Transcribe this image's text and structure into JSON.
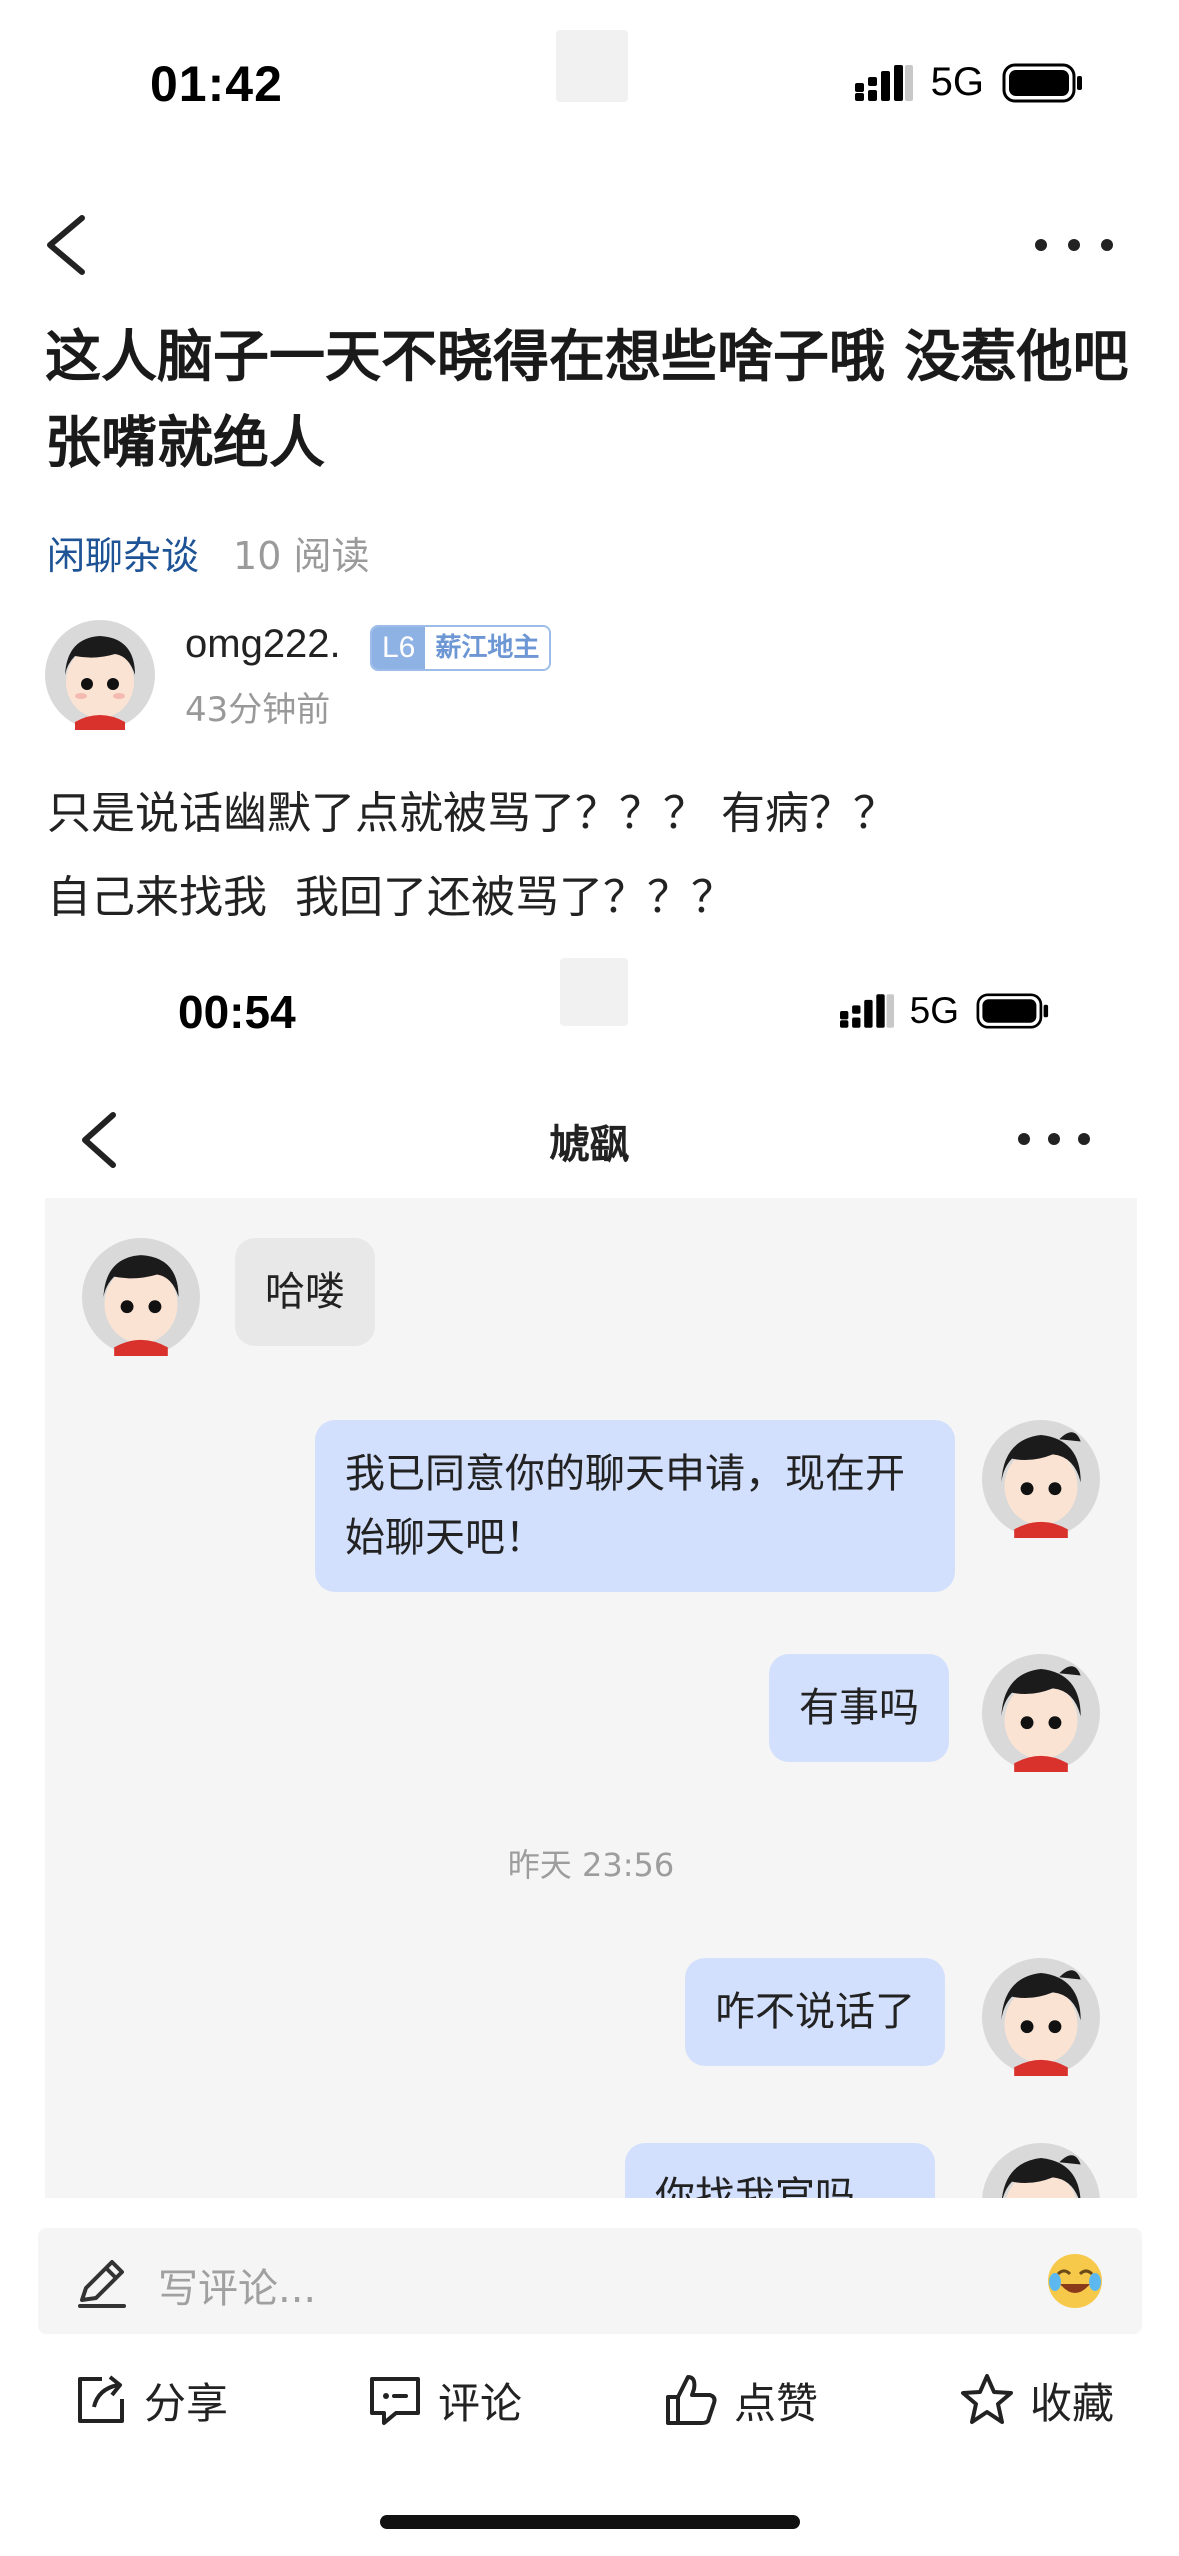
{
  "status_bar": {
    "time": "01:42",
    "network": "5G"
  },
  "post": {
    "title": " 这人脑子一天不晓得在想些啥子哦 没惹他吧 张嘴就绝人",
    "category": "闲聊杂谈",
    "reads": "10 阅读",
    "author": {
      "name": "omg222.",
      "level": "L6",
      "level_title": "薪江地主",
      "time_ago": "43分钟前"
    },
    "body_lines": [
      "只是说话幽默了点就被骂了？？？ 有病？？",
      "自己来找我  我回了还被骂了？？？"
    ]
  },
  "embedded_screenshot": {
    "status_bar": {
      "time": "00:54",
      "network": "5G"
    },
    "chat_title": "虓飖",
    "messages": [
      {
        "side": "left",
        "text": "哈喽"
      },
      {
        "side": "right",
        "text": "我已同意你的聊天申请，现在开始聊天吧！"
      },
      {
        "side": "right",
        "text": "有事吗"
      },
      {
        "type": "timestamp",
        "text": "昨天 23:56"
      },
      {
        "side": "right",
        "text": "咋不说话了"
      },
      {
        "side": "right",
        "text": "你找我官吗"
      }
    ]
  },
  "comment_input": {
    "placeholder": "写评论..."
  },
  "actions": {
    "share": "分享",
    "comment": "评论",
    "like": "点赞",
    "favorite": "收藏"
  },
  "icons": {
    "back": "chevron-left-icon",
    "more": "more-dots-icon",
    "pencil": "pencil-icon",
    "emoji": "laughing-emoji-icon",
    "share": "share-icon",
    "comment": "comment-icon",
    "like": "thumbs-up-icon",
    "favorite": "star-icon"
  },
  "colors": {
    "category": "#1e5496",
    "bubble_right": "#d3e0fd",
    "bubble_left": "#e8e8e8",
    "level_badge": "#8fb2e4"
  }
}
